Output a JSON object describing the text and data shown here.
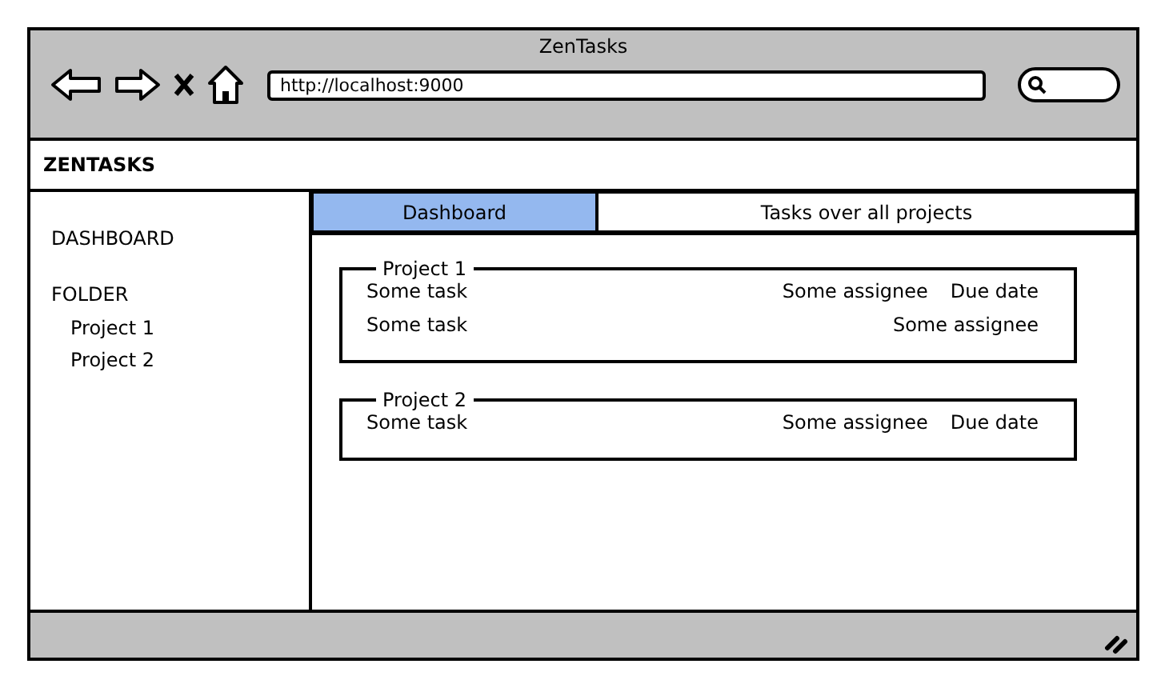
{
  "window": {
    "title": "ZenTasks",
    "url": "http://localhost:9000"
  },
  "header": {
    "title": "ZENTASKS"
  },
  "sidebar": {
    "items": [
      {
        "label": "DASHBOARD",
        "kind": "heading"
      },
      {
        "label": "FOLDER",
        "kind": "heading",
        "children": [
          {
            "label": "Project 1"
          },
          {
            "label": "Project 2"
          }
        ]
      }
    ]
  },
  "tabs": [
    {
      "label": "Dashboard",
      "selected": true
    },
    {
      "label": "Tasks over all projects",
      "selected": false
    }
  ],
  "projects": [
    {
      "title": "Project 1",
      "tasks": [
        {
          "name": "Some task",
          "assignee": "Some assignee",
          "due_date": "Due date"
        },
        {
          "name": "Some task",
          "assignee": "Some assignee"
        }
      ]
    },
    {
      "title": "Project 2",
      "tasks": [
        {
          "name": "Some task",
          "assignee": "Some assignee",
          "due_date": "Due date"
        }
      ]
    }
  ]
}
